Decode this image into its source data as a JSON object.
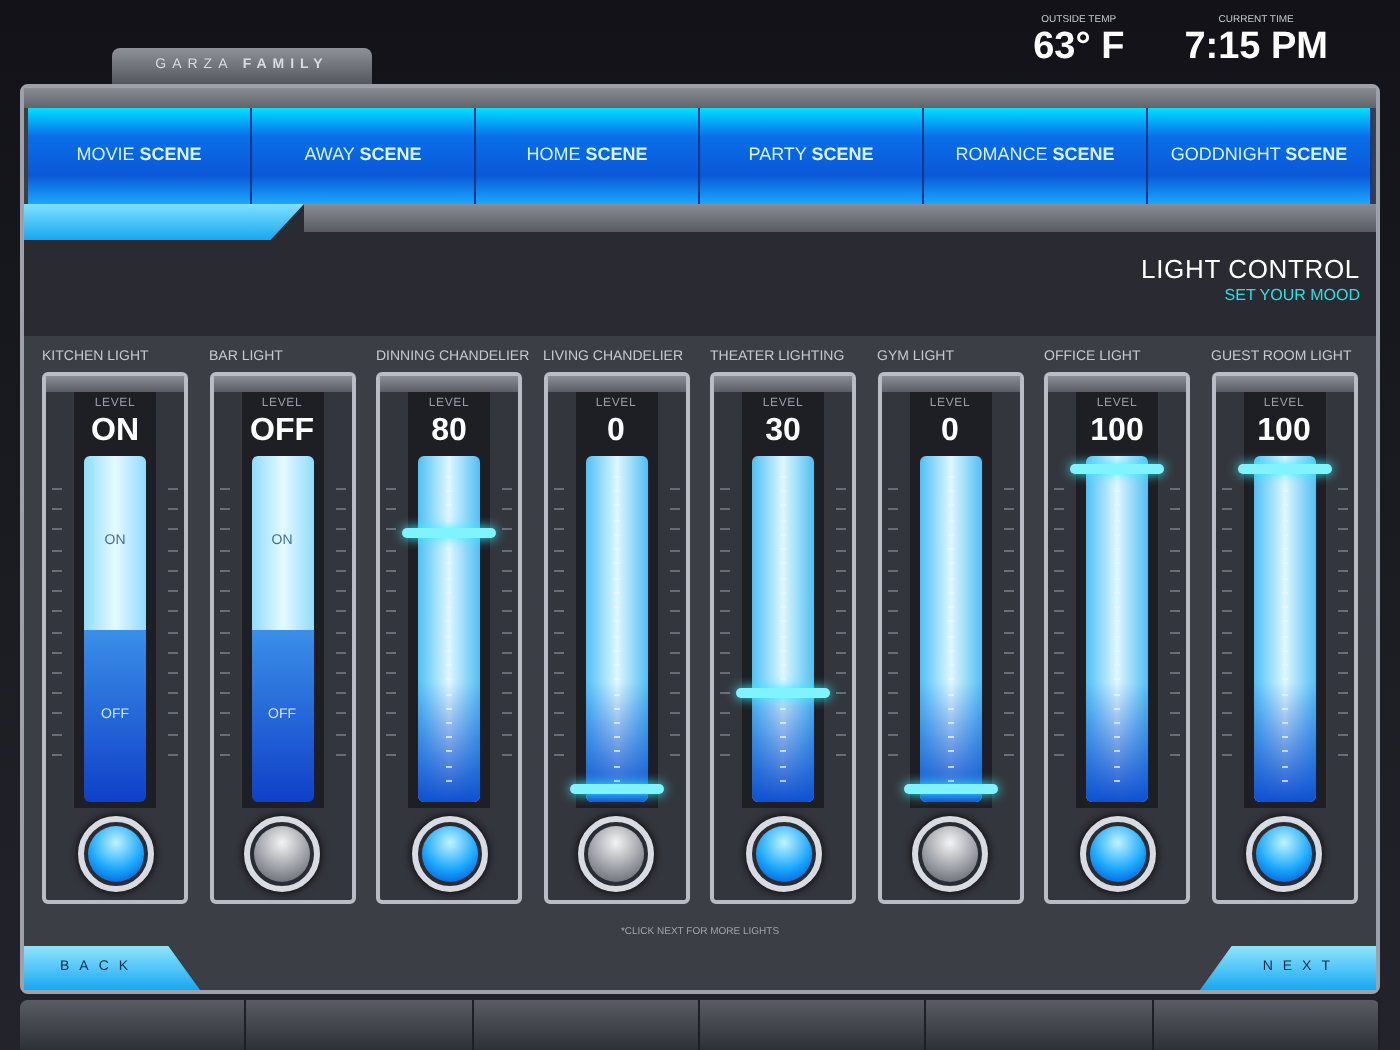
{
  "header": {
    "family": "GARZA **FAMILY**",
    "outside_temp": {
      "label": "OUTSIDE TEMP",
      "value": "63° F"
    },
    "current_time": {
      "label": "CURRENT TIME",
      "value": "7:15 PM"
    }
  },
  "scenes": [
    {
      "label": "MOVIE **SCENE**"
    },
    {
      "label": "AWAY **SCENE**"
    },
    {
      "label": "HOME **SCENE**"
    },
    {
      "label": "PARTY **SCENE**"
    },
    {
      "label": "ROMANCE **SCENE**"
    },
    {
      "label": "GODDNIGHT **SCENE**"
    }
  ],
  "section": {
    "title": "LIGHT CONTROL",
    "subtitle": "SET YOUR MOOD"
  },
  "lights": [
    {
      "name": "KITCHEN LIGHT",
      "kind": "switch",
      "level_label": "LEVEL",
      "value": "ON",
      "on": true,
      "on_label": "ON",
      "off_label": "OFF"
    },
    {
      "name": "BAR LIGHT",
      "kind": "switch",
      "level_label": "LEVEL",
      "value": "OFF",
      "on": false,
      "on_label": "ON",
      "off_label": "OFF"
    },
    {
      "name": "DINNING CHANDELIER",
      "kind": "dimmer",
      "level_label": "LEVEL",
      "value": "80",
      "on": true,
      "level": 0.8
    },
    {
      "name": "LIVING CHANDELIER",
      "kind": "dimmer",
      "level_label": "LEVEL",
      "value": "0",
      "on": false,
      "level": 0
    },
    {
      "name": "THEATER LIGHTING",
      "kind": "dimmer",
      "level_label": "LEVEL",
      "value": "30",
      "on": true,
      "level": 0.3
    },
    {
      "name": "GYM LIGHT",
      "kind": "dimmer",
      "level_label": "LEVEL",
      "value": "0",
      "on": false,
      "level": 0
    },
    {
      "name": "OFFICE LIGHT",
      "kind": "dimmer",
      "level_label": "LEVEL",
      "value": "100",
      "on": true,
      "level": 1
    },
    {
      "name": "GUEST ROOM LIGHT",
      "kind": "dimmer",
      "level_label": "LEVEL",
      "value": "100",
      "on": true,
      "level": 1
    }
  ],
  "footnote": "*CLICK NEXT FOR MORE LIGHTS",
  "nav": {
    "back": "BACK",
    "next": "NEXT"
  }
}
